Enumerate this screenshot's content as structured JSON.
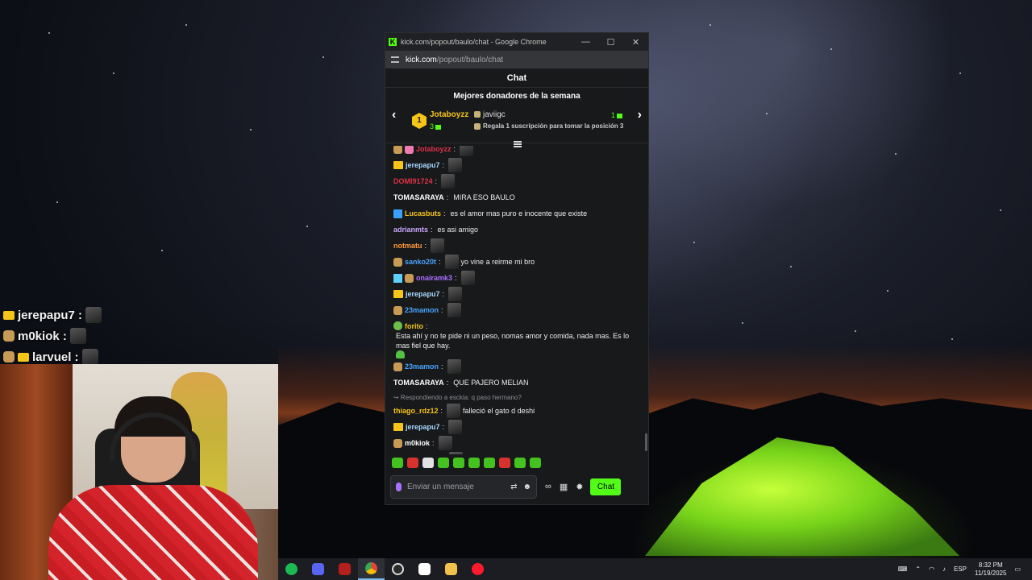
{
  "overlay_chat": [
    {
      "user": "jerepapu7 :",
      "badges": [
        "crown"
      ]
    },
    {
      "user": "m0kiok :",
      "badges": [
        "hand"
      ]
    },
    {
      "user": "larvuel :",
      "badges": [
        "hand",
        "crown"
      ]
    }
  ],
  "window": {
    "title": "kick.com/popout/baulo/chat - Google Chrome",
    "url_host": "kick.com",
    "url_path": "/popout/baulo/chat",
    "minimize": "—",
    "maximize": "☐",
    "close": "✕"
  },
  "chat": {
    "header": "Chat",
    "donors_title": "Mejores donadores de la semana",
    "rank": "1",
    "donor1_name": "Jotaboyzz",
    "donor1_count": "3",
    "donor2_name": "javiigc",
    "donor2_count": "1",
    "gift_note": "Regala 1 suscripción para tomar la posición 3"
  },
  "messages": [
    {
      "user": "Jotaboyzz",
      "color": "#e0314b",
      "badges": [
        "hand",
        "pink"
      ],
      "text": "",
      "emote": true
    },
    {
      "user": "jerepapu7",
      "color": "#a8d8ff",
      "badges": [
        "crown"
      ],
      "text": "",
      "emote": true
    },
    {
      "user": "DOMI91724",
      "color": "#e0314b",
      "badges": [],
      "text": "",
      "emote": true
    },
    {
      "user": "TOMASARAYA",
      "color": "#ffffff",
      "badges": [],
      "text": "MIRA ESO BAULO",
      "emote": false
    },
    {
      "user": "Lucasbuts",
      "color": "#f5c518",
      "badges": [
        "sword"
      ],
      "text": "es el amor mas puro e inocente que existe",
      "emote": false
    },
    {
      "user": "adrianmts",
      "color": "#c9a6ff",
      "badges": [],
      "text": "es asi amigo",
      "emote": false
    },
    {
      "user": "notmatu",
      "color": "#ff9a3c",
      "badges": [],
      "text": "",
      "emote": true
    },
    {
      "user": "sanko20t",
      "color": "#4aa3ff",
      "badges": [
        "hand"
      ],
      "text": "yo vine a reirme mi bro",
      "emote": true
    },
    {
      "user": "onairamk3",
      "color": "#a970ff",
      "badges": [
        "qr",
        "hand"
      ],
      "text": "",
      "emote": true
    },
    {
      "user": "jerepapu7",
      "color": "#a8d8ff",
      "badges": [
        "crown"
      ],
      "text": "",
      "emote": true
    },
    {
      "user": "23mamon",
      "color": "#4aa3ff",
      "badges": [
        "hand"
      ],
      "text": "",
      "emote": true
    },
    {
      "user": "forito",
      "color": "#f5c518",
      "badges": [
        "frog"
      ],
      "text": "Esta ahí y no te pide ni un peso, nomas amor y comida, nada mas. Es lo mas fiel que hay.",
      "emote": false,
      "heart": true
    },
    {
      "user": "23mamon",
      "color": "#4aa3ff",
      "badges": [
        "hand"
      ],
      "text": "",
      "emote": true
    },
    {
      "user": "TOMASARAYA",
      "color": "#ffffff",
      "badges": [],
      "text": "QUE PAJERO MELIAN",
      "emote": false
    },
    {
      "reply": "Respondiendo a esckia: q paso hermano?",
      "user": "thiago_rdz12",
      "color": "#f5c518",
      "badges": [],
      "text": "falleció el gato d deshi",
      "emote": true
    },
    {
      "user": "jerepapu7",
      "color": "#a8d8ff",
      "badges": [
        "crown"
      ],
      "text": "",
      "emote": true
    },
    {
      "user": "m0kiok",
      "color": "#ffffff",
      "badges": [
        "hand"
      ],
      "text": "",
      "emote": true
    },
    {
      "user": "larvuel",
      "color": "#b8ff6a",
      "badges": [
        "crown",
        "hand"
      ],
      "text": "",
      "emote": true
    }
  ],
  "input": {
    "placeholder": "Enviar un mensaje",
    "send_label": "Chat"
  },
  "taskbar": {
    "language": "ESP",
    "time": "8:32 PM",
    "date": "11/19/2025"
  }
}
